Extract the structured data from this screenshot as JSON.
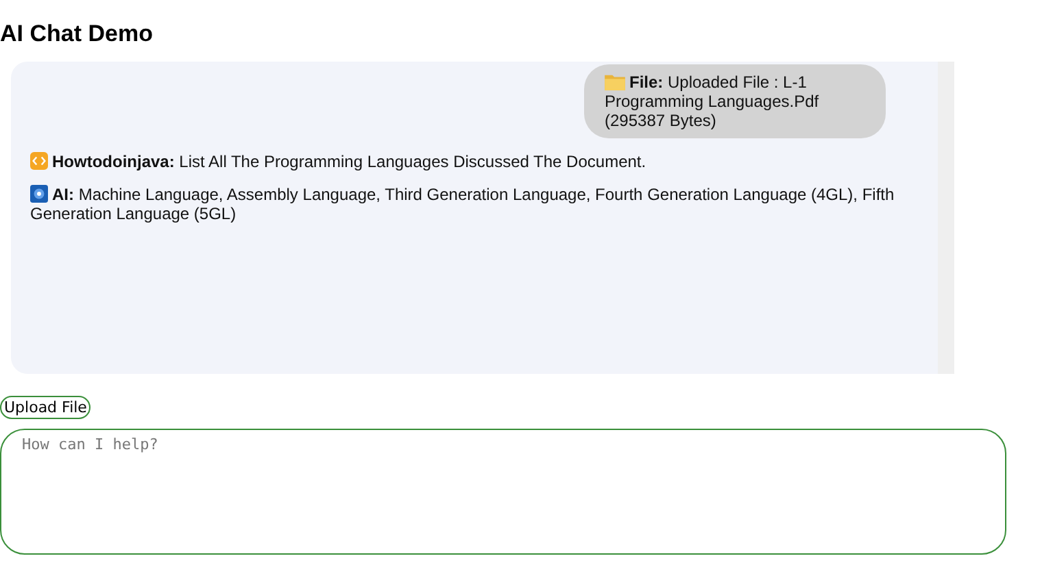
{
  "title": "AI Chat Demo",
  "messages": [
    {
      "kind": "file",
      "label": "File:",
      "text": "Uploaded File : L-1 Programming Languages.Pdf (295387 Bytes)"
    },
    {
      "kind": "user",
      "label": "Howtodoinjava:",
      "text": "List All The Programming Languages Discussed The Document."
    },
    {
      "kind": "ai",
      "label": "AI:",
      "text": "Machine Language, Assembly Language, Third Generation Language, Fourth Generation Language (4GL), Fifth Generation Language (5GL)"
    }
  ],
  "upload_button": "Upload File",
  "input": {
    "placeholder": "How can I help?"
  }
}
